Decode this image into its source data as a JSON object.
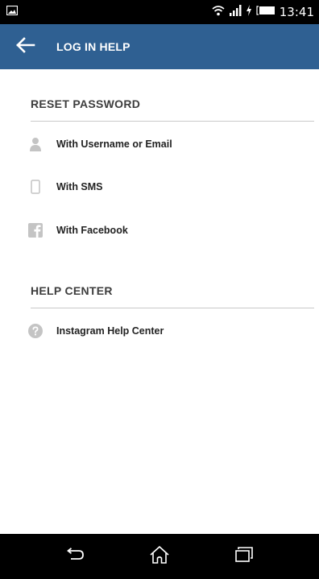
{
  "status_bar": {
    "time": "13:41",
    "icons": [
      "picture-notification-icon",
      "wifi-icon",
      "signal-icon",
      "charging-icon",
      "battery-icon"
    ]
  },
  "app_bar": {
    "title": "LOG IN HELP",
    "background": "#2f6092",
    "back_icon": "arrow-left-icon"
  },
  "reset_password": {
    "header": "RESET PASSWORD",
    "items": [
      {
        "label": "With Username or Email",
        "icon": "person-icon"
      },
      {
        "label": "With SMS",
        "icon": "phone-icon"
      },
      {
        "label": "With Facebook",
        "icon": "facebook-icon"
      }
    ]
  },
  "help_center": {
    "header": "HELP CENTER",
    "items": [
      {
        "label": "Instagram Help Center",
        "icon": "help-circle-icon"
      }
    ]
  },
  "nav_bar": {
    "buttons": [
      "back-icon",
      "home-icon",
      "recent-apps-icon"
    ]
  }
}
